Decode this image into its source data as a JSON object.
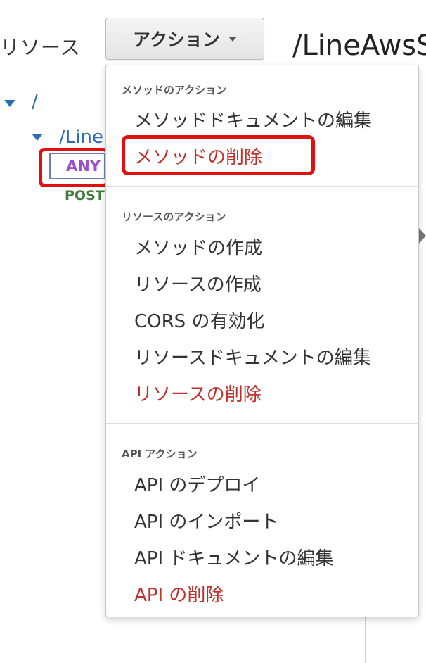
{
  "header": {
    "resources_label": "リソース",
    "actions_button": "アクション",
    "page_title": "/LineAwsS"
  },
  "tree": {
    "root": "/",
    "child": "/Line",
    "methods": [
      "ANY",
      "POST"
    ]
  },
  "dropdown": {
    "sections": [
      {
        "title": "メソッドのアクション",
        "items": [
          "メソッドドキュメントの編集",
          "メソッドの削除"
        ]
      },
      {
        "title": "リソースのアクション",
        "items": [
          "メソッドの作成",
          "リソースの作成",
          "CORS の有効化",
          "リソースドキュメントの編集",
          "リソースの削除"
        ]
      },
      {
        "title": "API アクション",
        "items": [
          "API のデプロイ",
          "API のインポート",
          "API ドキュメントの編集",
          "API の削除"
        ]
      }
    ]
  },
  "colors": {
    "danger": "#c0312c",
    "link": "#2f6db5",
    "highlight": "#e01010",
    "any_method": "#9b4dca",
    "post_method": "#3d7d3d"
  }
}
